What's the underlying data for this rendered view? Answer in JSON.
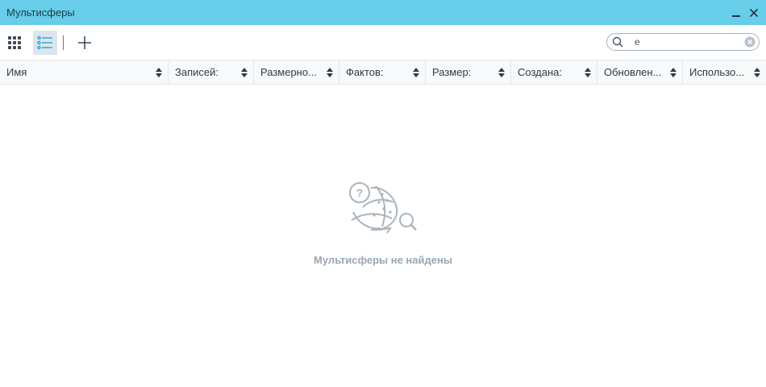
{
  "window": {
    "title": "Мультисферы"
  },
  "toolbar": {
    "grid_view": "grid-view-icon",
    "list_view": "list-view-icon",
    "add": "plus-icon"
  },
  "search": {
    "value": "е",
    "placeholder": ""
  },
  "table": {
    "columns": [
      {
        "label": "Имя"
      },
      {
        "label": "Записей:"
      },
      {
        "label": "Размерно..."
      },
      {
        "label": "Фактов:"
      },
      {
        "label": "Размер:"
      },
      {
        "label": "Создана:"
      },
      {
        "label": "Обновлен..."
      },
      {
        "label": "Использо..."
      }
    ]
  },
  "empty_state": {
    "message": "Мультисферы не найдены"
  },
  "colors": {
    "titlebar": "#67cde8",
    "accent": "#2aa6d5",
    "muted_text": "#9aa6b1"
  }
}
